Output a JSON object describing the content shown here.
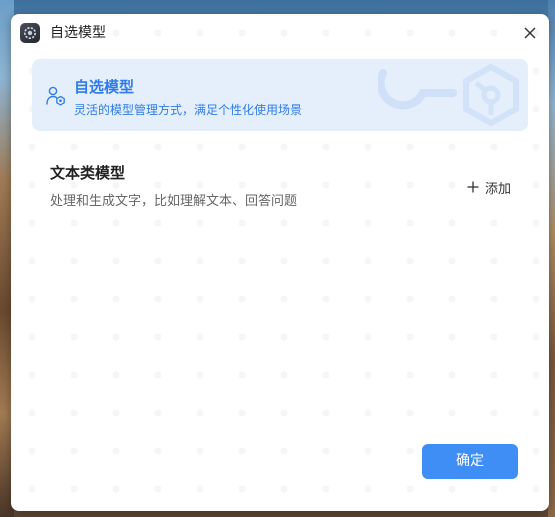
{
  "window": {
    "title": "自选模型",
    "app_icon": "app-gear-icon",
    "close_icon": "close-icon"
  },
  "banner": {
    "title": "自选模型",
    "subtitle": "灵活的模型管理方式，满足个性化使用场景",
    "icon": "user-settings-icon",
    "accent_color": "#2f7bea",
    "background_color": "#e5effc"
  },
  "section": {
    "title": "文本类模型",
    "description": "处理和生成文字，比如理解文本、回答问题",
    "add_label": "添加",
    "add_icon": "plus-icon"
  },
  "footer": {
    "confirm_label": "确定",
    "confirm_color": "#3f8ef5"
  }
}
